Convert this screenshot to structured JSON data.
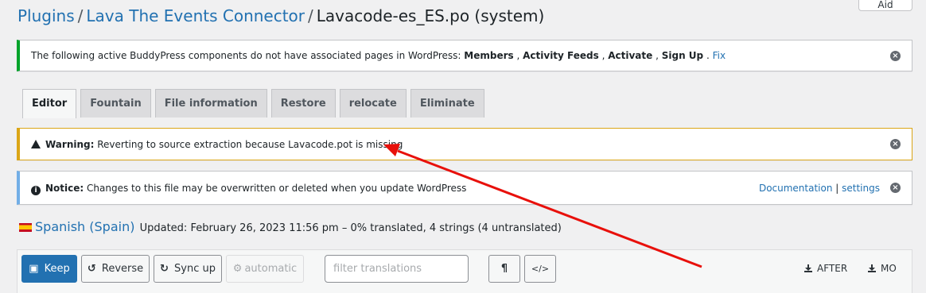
{
  "breadcrumb": {
    "plugins": "Plugins",
    "sep1": "/",
    "plugin": "Lava The Events Connector",
    "sep2": "/",
    "current": "Lavacode-es_ES.po (system)"
  },
  "help_button": "Aid",
  "notice_buddypress": {
    "text_before": "The following active BuddyPress components do not have associated pages in WordPress: ",
    "c1": "Members",
    "sep1": " , ",
    "c2": "Activity Feeds",
    "sep2": " , ",
    "c3": "Activate",
    "sep3": " , ",
    "c4": "Sign Up",
    "dot": " . ",
    "fix_link": "Fix"
  },
  "tabs": [
    "Editor",
    "Fountain",
    "File information",
    "Restore",
    "relocate",
    "Eliminate"
  ],
  "warning": {
    "label": "Warning:",
    "text": " Reverting to source extraction because Lavacode.pot is missing"
  },
  "info_notice": {
    "label": "Notice:",
    "text": " Changes to this file may be overwritten or deleted when you update WordPress",
    "doc_link": "Documentation",
    "pipe": " | ",
    "settings_link": "settings"
  },
  "language": {
    "name": "Spanish (Spain)",
    "status": "Updated: February 26, 2023 11:56 pm – 0% translated, 4 strings (4 untranslated)"
  },
  "toolbar": {
    "keep": "Keep",
    "reverse": "Reverse",
    "sync": "Sync up",
    "automatic": "automatic",
    "filter_placeholder": "filter translations",
    "pilcrow": "¶",
    "code": "</>",
    "after": "AFTER",
    "mo": "MO"
  },
  "colors": {
    "link": "#2271b1",
    "success_border": "#00a32a",
    "warning_border": "#dba617",
    "info_border": "#72aee6",
    "annotation_arrow": "#e8100b"
  }
}
